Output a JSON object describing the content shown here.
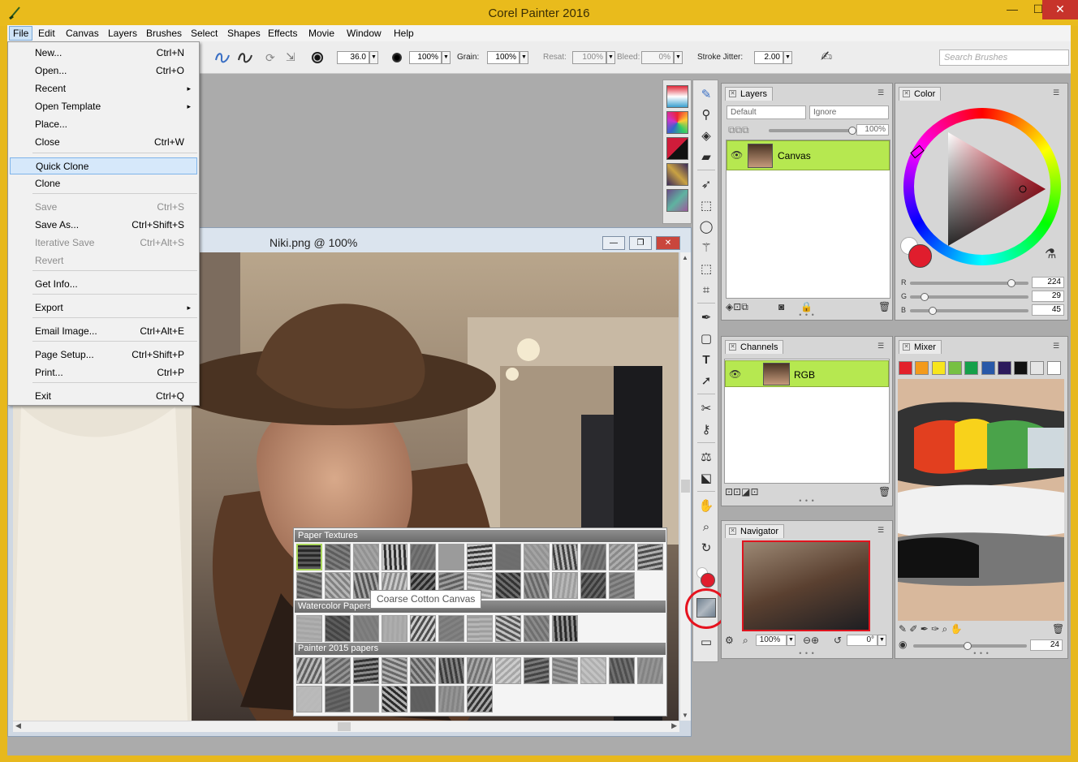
{
  "window": {
    "title": "Corel Painter 2016",
    "minimize": "—",
    "maximize": "☐",
    "close": "✕"
  },
  "menubar": [
    "File",
    "Edit",
    "Canvas",
    "Layers",
    "Brushes",
    "Select",
    "Shapes",
    "Effects",
    "Movie",
    "Window",
    "Help"
  ],
  "file_menu": {
    "items": [
      {
        "label": "New...",
        "shortcut": "Ctrl+N"
      },
      {
        "label": "Open...",
        "shortcut": "Ctrl+O"
      },
      {
        "label": "Recent",
        "shortcut": "▸"
      },
      {
        "label": "Open Template",
        "shortcut": "▸"
      },
      {
        "label": "Place...",
        "shortcut": ""
      },
      {
        "label": "Close",
        "shortcut": "Ctrl+W"
      },
      {
        "label": "Quick Clone",
        "shortcut": ""
      },
      {
        "label": "Clone",
        "shortcut": ""
      },
      {
        "label": "Save",
        "shortcut": "Ctrl+S"
      },
      {
        "label": "Save As...",
        "shortcut": "Ctrl+Shift+S"
      },
      {
        "label": "Iterative Save",
        "shortcut": "Ctrl+Alt+S"
      },
      {
        "label": "Revert",
        "shortcut": ""
      },
      {
        "label": "Get Info...",
        "shortcut": ""
      },
      {
        "label": "Export",
        "shortcut": "▸"
      },
      {
        "label": "Email Image...",
        "shortcut": "Ctrl+Alt+E"
      },
      {
        "label": "Page Setup...",
        "shortcut": "Ctrl+Shift+P"
      },
      {
        "label": "Print...",
        "shortcut": "Ctrl+P"
      },
      {
        "label": "Exit",
        "shortcut": "Ctrl+Q"
      }
    ]
  },
  "propbar": {
    "size": "36.0",
    "opacity": "100%",
    "grain_label": "Grain:",
    "grain": "100%",
    "resat_label": "Resat:",
    "resat": "100%",
    "bleed_label": "Bleed:",
    "bleed": "0%",
    "jitter_label": "Stroke Jitter:",
    "jitter": "2.00",
    "search_placeholder": "Search Brushes"
  },
  "document": {
    "title": "Niki.png @ 100%"
  },
  "paper_popup": {
    "sections": [
      "Paper Textures",
      "Watercolor Papers",
      "Painter 2015 papers"
    ],
    "tooltip": "Coarse Cotton Canvas"
  },
  "layers_panel": {
    "tab": "Layers",
    "composite_method": "Default",
    "preserve": "Ignore",
    "opacity": "100%",
    "layer_name": "Canvas"
  },
  "color_panel": {
    "tab": "Color",
    "r_label": "R",
    "r": "224",
    "g_label": "G",
    "g": "29",
    "b_label": "B",
    "b": "45",
    "main_color": "#e01d2d"
  },
  "channels_panel": {
    "tab": "Channels",
    "channel_name": "RGB"
  },
  "mixer_panel": {
    "tab": "Mixer",
    "swatches": [
      "#e2212b",
      "#f39a1b",
      "#f7e51d",
      "#77c043",
      "#15a04a",
      "#2858a8",
      "#2c1a5c",
      "#111111",
      "#e5e5e5",
      "#ffffff"
    ],
    "brush_size": "24"
  },
  "navigator_panel": {
    "tab": "Navigator",
    "zoom": "100%",
    "rotation": "0°"
  }
}
